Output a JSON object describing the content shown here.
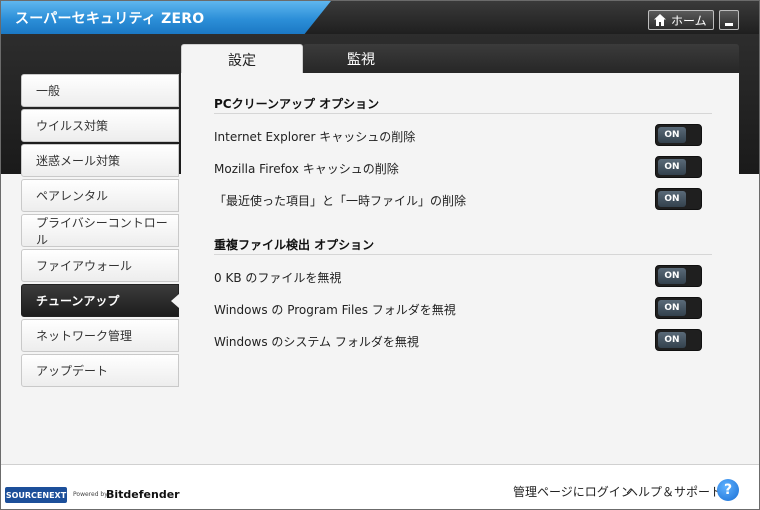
{
  "window": {
    "title": "スーパーセキュリティ ZERO",
    "home_label": "ホーム"
  },
  "tabs": [
    {
      "label": "設定",
      "active": true
    },
    {
      "label": "監視",
      "active": false
    }
  ],
  "sidebar": {
    "items": [
      {
        "label": "一般"
      },
      {
        "label": "ウイルス対策"
      },
      {
        "label": "迷惑メール対策"
      },
      {
        "label": "ペアレンタル"
      },
      {
        "label": "プライバシーコントロール"
      },
      {
        "label": "ファイアウォール"
      },
      {
        "label": "チューンアップ",
        "active": true
      },
      {
        "label": "ネットワーク管理"
      },
      {
        "label": "アップデート"
      }
    ]
  },
  "sections": [
    {
      "title": "PCクリーンアップ オプション",
      "options": [
        {
          "label": "Internet Explorer キャッシュの削除",
          "state": "ON"
        },
        {
          "label": "Mozilla Firefox キャッシュの削除",
          "state": "ON"
        },
        {
          "label": "「最近使った項目」と「一時ファイル」の削除",
          "state": "ON"
        }
      ]
    },
    {
      "title": "重複ファイル検出 オプション",
      "options": [
        {
          "label": "0 KB のファイルを無視",
          "state": "ON"
        },
        {
          "label": "Windows の Program Files フォルダを無視",
          "state": "ON"
        },
        {
          "label": "Windows のシステム フォルダを無視",
          "state": "ON"
        }
      ]
    }
  ],
  "footer": {
    "brand": "SOURCENEXT",
    "powered_by": "Powered by",
    "partner": "Bitdefender",
    "login_link": "管理ページにログイン",
    "help_link": "ヘルプ＆サポート",
    "help_icon_glyph": "?"
  },
  "colors": {
    "accent_blue": "#2c8fd8",
    "dark_bar": "#1f1f1f",
    "toggle_on": "#33414d"
  },
  "icons": {
    "home": "home-icon",
    "minimize": "minimize-icon",
    "help": "help-icon"
  }
}
